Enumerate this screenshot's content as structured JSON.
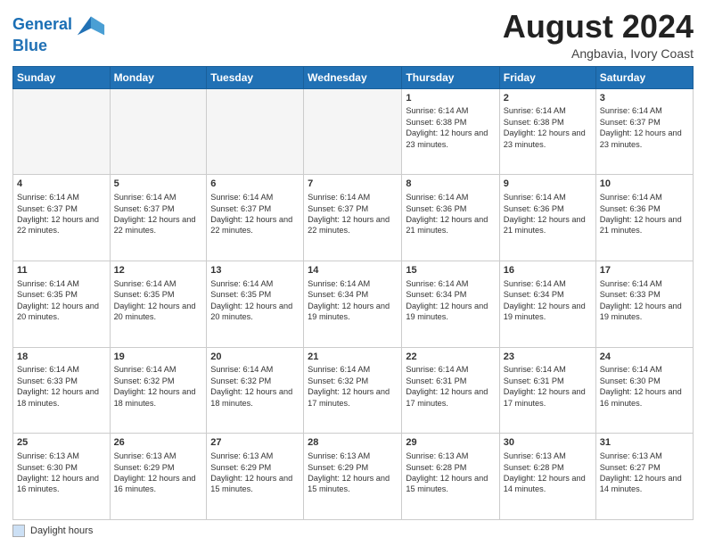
{
  "header": {
    "logo_line1": "General",
    "logo_line2": "Blue",
    "month_title": "August 2024",
    "subtitle": "Angbavia, Ivory Coast"
  },
  "footer": {
    "legend_label": "Daylight hours"
  },
  "weekdays": [
    "Sunday",
    "Monday",
    "Tuesday",
    "Wednesday",
    "Thursday",
    "Friday",
    "Saturday"
  ],
  "weeks": [
    [
      {
        "num": "",
        "info": ""
      },
      {
        "num": "",
        "info": ""
      },
      {
        "num": "",
        "info": ""
      },
      {
        "num": "",
        "info": ""
      },
      {
        "num": "1",
        "info": "Sunrise: 6:14 AM\nSunset: 6:38 PM\nDaylight: 12 hours\nand 23 minutes."
      },
      {
        "num": "2",
        "info": "Sunrise: 6:14 AM\nSunset: 6:38 PM\nDaylight: 12 hours\nand 23 minutes."
      },
      {
        "num": "3",
        "info": "Sunrise: 6:14 AM\nSunset: 6:37 PM\nDaylight: 12 hours\nand 23 minutes."
      }
    ],
    [
      {
        "num": "4",
        "info": "Sunrise: 6:14 AM\nSunset: 6:37 PM\nDaylight: 12 hours\nand 22 minutes."
      },
      {
        "num": "5",
        "info": "Sunrise: 6:14 AM\nSunset: 6:37 PM\nDaylight: 12 hours\nand 22 minutes."
      },
      {
        "num": "6",
        "info": "Sunrise: 6:14 AM\nSunset: 6:37 PM\nDaylight: 12 hours\nand 22 minutes."
      },
      {
        "num": "7",
        "info": "Sunrise: 6:14 AM\nSunset: 6:37 PM\nDaylight: 12 hours\nand 22 minutes."
      },
      {
        "num": "8",
        "info": "Sunrise: 6:14 AM\nSunset: 6:36 PM\nDaylight: 12 hours\nand 21 minutes."
      },
      {
        "num": "9",
        "info": "Sunrise: 6:14 AM\nSunset: 6:36 PM\nDaylight: 12 hours\nand 21 minutes."
      },
      {
        "num": "10",
        "info": "Sunrise: 6:14 AM\nSunset: 6:36 PM\nDaylight: 12 hours\nand 21 minutes."
      }
    ],
    [
      {
        "num": "11",
        "info": "Sunrise: 6:14 AM\nSunset: 6:35 PM\nDaylight: 12 hours\nand 20 minutes."
      },
      {
        "num": "12",
        "info": "Sunrise: 6:14 AM\nSunset: 6:35 PM\nDaylight: 12 hours\nand 20 minutes."
      },
      {
        "num": "13",
        "info": "Sunrise: 6:14 AM\nSunset: 6:35 PM\nDaylight: 12 hours\nand 20 minutes."
      },
      {
        "num": "14",
        "info": "Sunrise: 6:14 AM\nSunset: 6:34 PM\nDaylight: 12 hours\nand 19 minutes."
      },
      {
        "num": "15",
        "info": "Sunrise: 6:14 AM\nSunset: 6:34 PM\nDaylight: 12 hours\nand 19 minutes."
      },
      {
        "num": "16",
        "info": "Sunrise: 6:14 AM\nSunset: 6:34 PM\nDaylight: 12 hours\nand 19 minutes."
      },
      {
        "num": "17",
        "info": "Sunrise: 6:14 AM\nSunset: 6:33 PM\nDaylight: 12 hours\nand 19 minutes."
      }
    ],
    [
      {
        "num": "18",
        "info": "Sunrise: 6:14 AM\nSunset: 6:33 PM\nDaylight: 12 hours\nand 18 minutes."
      },
      {
        "num": "19",
        "info": "Sunrise: 6:14 AM\nSunset: 6:32 PM\nDaylight: 12 hours\nand 18 minutes."
      },
      {
        "num": "20",
        "info": "Sunrise: 6:14 AM\nSunset: 6:32 PM\nDaylight: 12 hours\nand 18 minutes."
      },
      {
        "num": "21",
        "info": "Sunrise: 6:14 AM\nSunset: 6:32 PM\nDaylight: 12 hours\nand 17 minutes."
      },
      {
        "num": "22",
        "info": "Sunrise: 6:14 AM\nSunset: 6:31 PM\nDaylight: 12 hours\nand 17 minutes."
      },
      {
        "num": "23",
        "info": "Sunrise: 6:14 AM\nSunset: 6:31 PM\nDaylight: 12 hours\nand 17 minutes."
      },
      {
        "num": "24",
        "info": "Sunrise: 6:14 AM\nSunset: 6:30 PM\nDaylight: 12 hours\nand 16 minutes."
      }
    ],
    [
      {
        "num": "25",
        "info": "Sunrise: 6:13 AM\nSunset: 6:30 PM\nDaylight: 12 hours\nand 16 minutes."
      },
      {
        "num": "26",
        "info": "Sunrise: 6:13 AM\nSunset: 6:29 PM\nDaylight: 12 hours\nand 16 minutes."
      },
      {
        "num": "27",
        "info": "Sunrise: 6:13 AM\nSunset: 6:29 PM\nDaylight: 12 hours\nand 15 minutes."
      },
      {
        "num": "28",
        "info": "Sunrise: 6:13 AM\nSunset: 6:29 PM\nDaylight: 12 hours\nand 15 minutes."
      },
      {
        "num": "29",
        "info": "Sunrise: 6:13 AM\nSunset: 6:28 PM\nDaylight: 12 hours\nand 15 minutes."
      },
      {
        "num": "30",
        "info": "Sunrise: 6:13 AM\nSunset: 6:28 PM\nDaylight: 12 hours\nand 14 minutes."
      },
      {
        "num": "31",
        "info": "Sunrise: 6:13 AM\nSunset: 6:27 PM\nDaylight: 12 hours\nand 14 minutes."
      }
    ]
  ]
}
